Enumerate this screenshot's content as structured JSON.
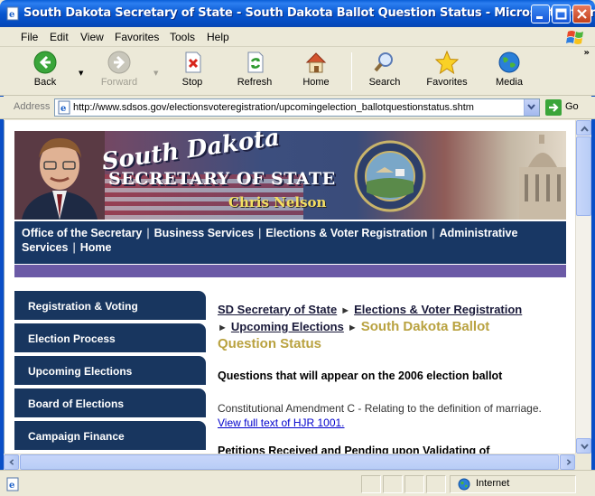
{
  "window": {
    "title": "South Dakota Secretary of State - South Dakota Ballot Question Status - Microsoft Intern..."
  },
  "menu": [
    "File",
    "Edit",
    "View",
    "Favorites",
    "Tools",
    "Help"
  ],
  "toolbar": {
    "back": "Back",
    "forward": "Forward",
    "stop": "Stop",
    "refresh": "Refresh",
    "home": "Home",
    "search": "Search",
    "favorites": "Favorites",
    "media": "Media",
    "more": "»"
  },
  "address": {
    "label": "Address",
    "url": "http://www.sdsos.gov/electionsvoteregistration/upcomingelection_ballotquestionstatus.shtm",
    "go": "Go"
  },
  "banner": {
    "logo_text": "South Dakota",
    "heading": "SECRETARY OF STATE",
    "name": "Chris Nelson"
  },
  "topnav": {
    "items": [
      "Office of the Secretary",
      "Business Services",
      "Elections & Voter Registration",
      "Administrative",
      "Services",
      "Home"
    ]
  },
  "sidenav": {
    "items": [
      "Registration & Voting",
      "Election Process",
      "Upcoming Elections",
      "Board of Elections",
      "Campaign Finance"
    ]
  },
  "breadcrumb": {
    "crumb1": "SD Secretary of State",
    "crumb2": "Elections & Voter Registration",
    "crumb3": "Upcoming Elections",
    "current": "South Dakota Ballot Question Status"
  },
  "content": {
    "heading": "Questions that will appear on the 2006 election ballot",
    "para_text": "Constitutional Amendment C - Relating to the definition of marriage. ",
    "para_link": "View full text of HJR 1001.",
    "heading2": "Petitions Received and Pending upon Validating of"
  },
  "status": {
    "zone": "Internet"
  }
}
